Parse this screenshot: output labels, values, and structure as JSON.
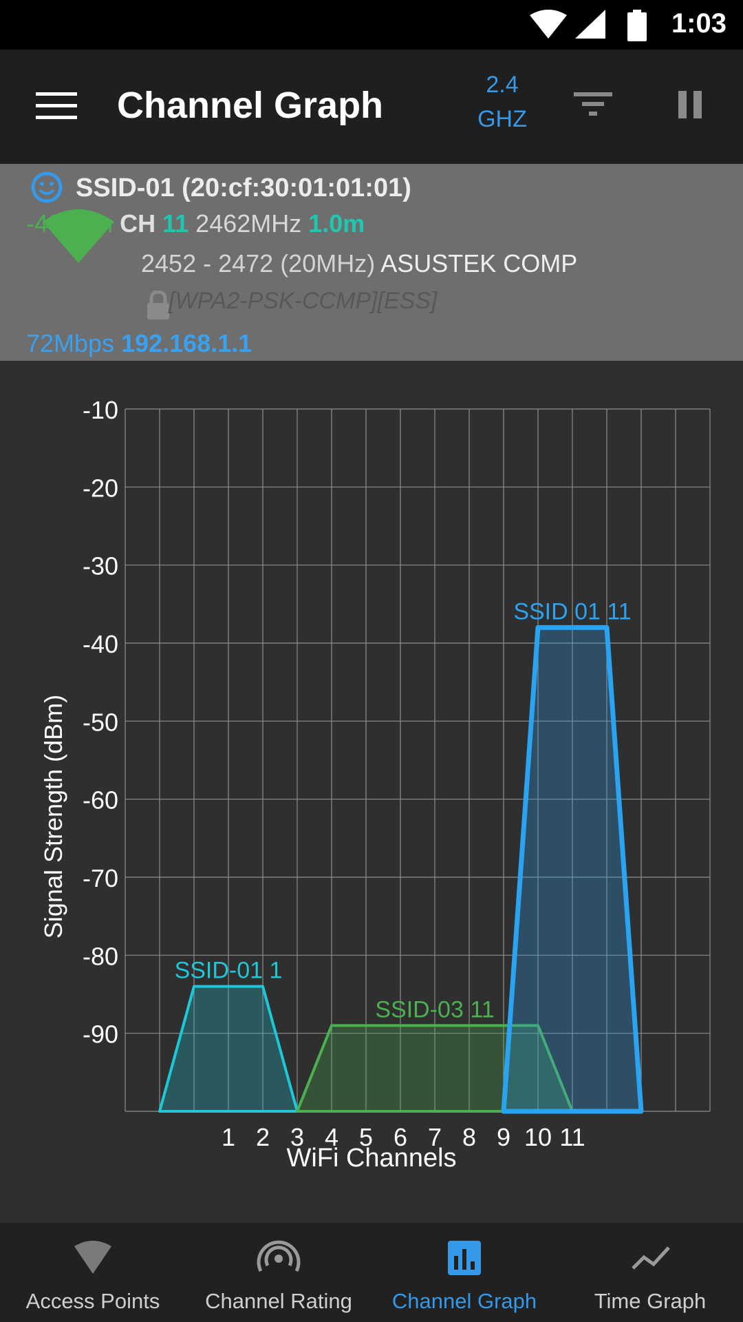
{
  "status_bar": {
    "time": "1:03"
  },
  "app_bar": {
    "title": "Channel Graph",
    "band_line1": "2.4",
    "band_line2": "GHZ"
  },
  "connection": {
    "ssid": "SSID-01 (20:cf:30:01:01:01)",
    "signal": "-40dBm",
    "ch_label": "CH",
    "channel": "11",
    "frequency": "2462MHz",
    "distance": "1.0m",
    "range": "2452 - 2472",
    "width": "(20MHz)",
    "vendor": "ASUSTEK COMP",
    "security": "[WPA2-PSK-CCMP][ESS]",
    "speed": "72Mbps",
    "ip": "192.168.1.1"
  },
  "colors": {
    "ssid01_ch1": "#1ec8d8",
    "ssid03_ch11": "#4caf50",
    "ssid01_ch11": "#2aa3f0",
    "accent": "#3399e8"
  },
  "chart_data": {
    "type": "area",
    "xlabel": "WiFi Channels",
    "ylabel": "Signal Strength (dBm)",
    "x_ticks": [
      "1",
      "2",
      "3",
      "4",
      "5",
      "6",
      "7",
      "8",
      "9",
      "10",
      "11"
    ],
    "y_ticks": [
      "-10",
      "-20",
      "-30",
      "-40",
      "-50",
      "-60",
      "-70",
      "-80",
      "-90"
    ],
    "xlim": [
      -2,
      15
    ],
    "ylim": [
      -100,
      -10
    ],
    "grid": true,
    "series": [
      {
        "name": "SSID-01 1",
        "color": "#1ec8d8",
        "points": [
          [
            -1,
            -100
          ],
          [
            0,
            -84
          ],
          [
            2,
            -84
          ],
          [
            3,
            -100
          ]
        ]
      },
      {
        "name": "SSID-03 11",
        "color": "#4caf50",
        "points": [
          [
            3,
            -100
          ],
          [
            4,
            -89
          ],
          [
            10,
            -89
          ],
          [
            11,
            -100
          ]
        ]
      },
      {
        "name": "SSID 01 11",
        "color": "#2aa3f0",
        "points": [
          [
            9,
            -100
          ],
          [
            10,
            -38
          ],
          [
            12,
            -38
          ],
          [
            13,
            -100
          ]
        ]
      }
    ]
  },
  "bottom_nav": {
    "items": [
      {
        "label": "Access Points",
        "icon": "wifi-icon"
      },
      {
        "label": "Channel Rating",
        "icon": "signal-rating-icon"
      },
      {
        "label": "Channel Graph",
        "icon": "bar-chart-icon"
      },
      {
        "label": "Time Graph",
        "icon": "line-chart-icon"
      }
    ]
  }
}
